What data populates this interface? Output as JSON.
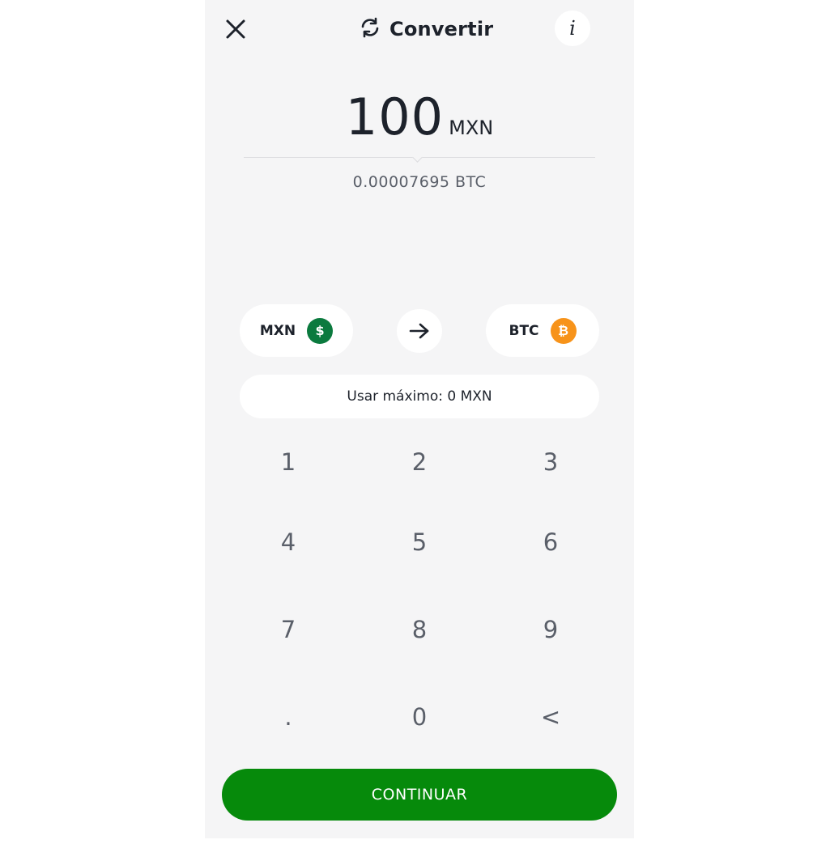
{
  "header": {
    "title": "Convertir",
    "close_icon": "close-icon",
    "refresh_icon": "refresh-icon",
    "info_label": "i"
  },
  "amount": {
    "value": "100",
    "currency": "MXN"
  },
  "converted": {
    "text": "0.00007695 BTC"
  },
  "pair": {
    "from_label": "MXN",
    "from_icon_glyph": "$",
    "from_color": "#0b7a3e",
    "to_label": "BTC",
    "to_icon_glyph": "₿",
    "to_color": "#f7931a",
    "swap_icon": "arrow-right-icon"
  },
  "max_button": {
    "label": "Usar máximo: 0 MXN"
  },
  "keypad": {
    "keys": [
      "1",
      "2",
      "3",
      "4",
      "5",
      "6",
      "7",
      "8",
      "9",
      ".",
      "0",
      "<"
    ]
  },
  "continue_button": {
    "label": "CONTINUAR",
    "color": "#068a0b"
  }
}
